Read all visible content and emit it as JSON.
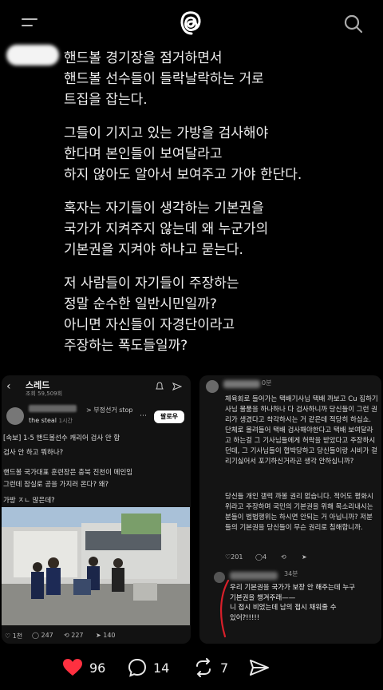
{
  "post": {
    "paragraphs": [
      [
        "핸드볼 경기장을 점거하면서",
        "핸드볼 선수들이 들락날락하는 거로",
        "트집을 잡는다."
      ],
      [
        "그들이 기지고 있는 가방을 검사해야",
        "한다며 본인들이 보여달라고",
        "하지 않아도 알아서 보여주고 가야 한단다."
      ],
      [
        "혹자는 자기들이 생각하는 기본권을",
        "국가가 지켜주지 않는데 왜 누군가의",
        "기본권을 지켜야 하냐고 묻는다."
      ],
      [
        "저 사람들이 자기들이 주장하는",
        "정말 순수한 일반시민일까?",
        "아니면 자신들이 자경단이라고",
        "주장하는 폭도들일까?"
      ]
    ]
  },
  "left_shot": {
    "header_title": "스레드",
    "views": "조회 59,509회",
    "sub_label": "the steal",
    "time": "1시간",
    "quote_label": "> 부정선거 stop",
    "follow_label": "팔로우",
    "lines": [
      "[속보] 1-5 핸드볼선수 캐리어 검사 안 함",
      "검사 안 하고 뭐하나?",
      "핸드볼 국가대표 훈련장은 충북 진천이 메인임",
      "그런데 잠실로 공을 가지러 온다? 왜?",
      "가방 ㅈㄴ 많은데?"
    ],
    "actions": {
      "like": "1천",
      "comment": "247",
      "repost": "227",
      "share": "140"
    }
  },
  "right_shot": {
    "time": "0분",
    "comment_paragraphs": [
      "체육회로 들어가는 택배기사님 택배 까보고 Cu 집하기사님 물품을 하나하나 다 검사하니까 당신들이 그런 권리가 생겼다고 착각하시는 거 같은데 적당히 하십쇼. 단체로 몰려들어 택배 검사해야한다고 택배 보여달라고 하는걸 그 기사님들에게 허락을 받았다고 주장하시던데, 그 기사님들이 협박당하고 당신들이랑 시비가 걸리기싫어서 포기하신거라곤 생각 안하십니까?",
      "당신들 개인 갤럭 까볼 권리 없습니다. 적어도 평화시위라고 주장하며 국민의 기본권을 위해 목소리내시는 분들이 범법행위는 하시면 안되는 거 아닙니까? 저분들의 기본권을 당신들이 무슨 권리로 침해합니까."
    ],
    "actions": {
      "like": "201",
      "comment": "4",
      "repost": "",
      "share": ""
    },
    "reply_time": "34분",
    "reply_lines": [
      "우리 기본권을 국가가 보장 안 해주는데 누구",
      "기본권을 챙겨주래——",
      "니 접시 비었는데 남의 접시 채워줄 수",
      "있어?!!!!!"
    ]
  },
  "bottom": {
    "likes": "96",
    "comments": "14",
    "reposts": "7"
  },
  "colors": {
    "like_red": "#ff3040",
    "background": "#000000",
    "text": "#f2f2f2"
  },
  "icons": [
    "menu-icon",
    "threads-logo-icon",
    "search-icon",
    "heart-icon",
    "comment-icon",
    "repost-icon",
    "share-icon"
  ]
}
